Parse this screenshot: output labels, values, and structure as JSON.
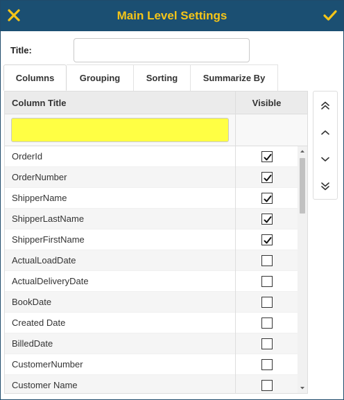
{
  "header": {
    "title": "Main Level Settings",
    "close_icon": "close-icon",
    "confirm_icon": "check-icon",
    "background": "#1b4f72",
    "accent": "#f5c518"
  },
  "title_field": {
    "label": "Title:",
    "value": ""
  },
  "tabs": [
    {
      "label": "Columns",
      "active": true
    },
    {
      "label": "Grouping",
      "active": false
    },
    {
      "label": "Sorting",
      "active": false
    },
    {
      "label": "Summarize By",
      "active": false
    }
  ],
  "grid": {
    "columns": {
      "title": "Column Title",
      "visible": "Visible"
    },
    "filter": {
      "value": "",
      "background": "#ffff44"
    },
    "rows": [
      {
        "label": "OrderId",
        "visible": true
      },
      {
        "label": "OrderNumber",
        "visible": true
      },
      {
        "label": "ShipperName",
        "visible": true
      },
      {
        "label": "ShipperLastName",
        "visible": true
      },
      {
        "label": "ShipperFirstName",
        "visible": true
      },
      {
        "label": "ActualLoadDate",
        "visible": false
      },
      {
        "label": "ActualDeliveryDate",
        "visible": false
      },
      {
        "label": "BookDate",
        "visible": false
      },
      {
        "label": "Created Date",
        "visible": false
      },
      {
        "label": "BilledDate",
        "visible": false
      },
      {
        "label": "CustomerNumber",
        "visible": false
      },
      {
        "label": "Customer Name",
        "visible": false
      }
    ]
  },
  "move_buttons": [
    {
      "icon": "double-chevron-up-icon"
    },
    {
      "icon": "chevron-up-icon"
    },
    {
      "icon": "chevron-down-icon"
    },
    {
      "icon": "double-chevron-down-icon"
    }
  ]
}
